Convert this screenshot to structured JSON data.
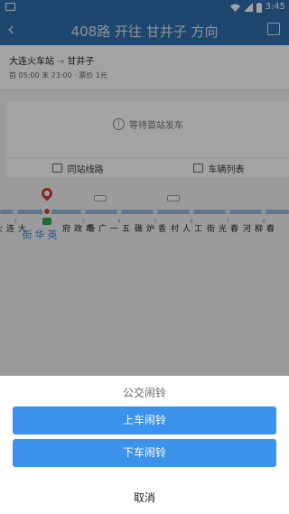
{
  "status_bar": {
    "time": "3:45",
    "icons": [
      "notification-icon",
      "wifi-icon",
      "signal-icon",
      "battery-icon"
    ]
  },
  "header": {
    "title": "408路 开往 甘井子 方向"
  },
  "route": {
    "from": "大连火车站",
    "to": "甘井子",
    "schedule": "首 05:00 末 23:00 · 票价 1元"
  },
  "status_card": {
    "message": "等待首站发车"
  },
  "tabs": [
    {
      "label": "同站线路"
    },
    {
      "label": "车辆列表"
    }
  ],
  "stops": [
    {
      "num": "1",
      "name": "大连火车站"
    },
    {
      "num": "2",
      "name": "英华街",
      "current": true
    },
    {
      "num": "3",
      "name": "市政府"
    },
    {
      "num": "4",
      "name": "五一广场"
    },
    {
      "num": "5",
      "name": "香炉礁"
    },
    {
      "num": "6",
      "name": "工人村"
    },
    {
      "num": "7",
      "name": "春光街"
    },
    {
      "num": "8",
      "name": "春柳河"
    }
  ],
  "sheet": {
    "title": "公交闹铃",
    "board_label": "上车闹铃",
    "alight_label": "下车闹铃",
    "cancel_label": "取消"
  },
  "colors": {
    "primary": "#2f6fae",
    "button": "#3b92ea",
    "current_stop": "#2f8fe6",
    "pin": "#d43c3c"
  }
}
